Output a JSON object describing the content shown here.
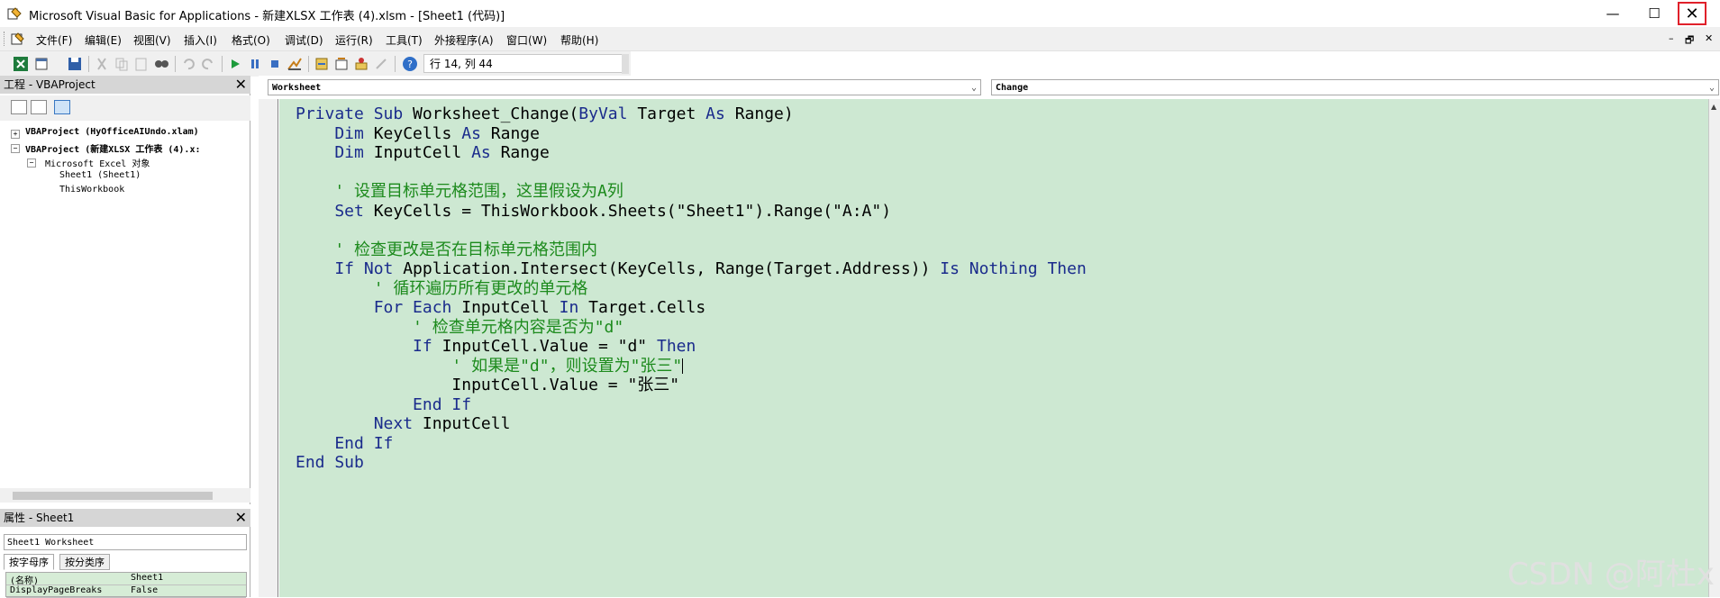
{
  "window": {
    "title": "Microsoft Visual Basic for Applications - 新建XLSX 工作表 (4).xlsm - [Sheet1 (代码)]",
    "minimize": "—",
    "maximize": "☐",
    "close": "✕"
  },
  "menu": {
    "items": [
      "文件(F)",
      "编辑(E)",
      "视图(V)",
      "插入(I)",
      "格式(O)",
      "调试(D)",
      "运行(R)",
      "工具(T)",
      "外接程序(A)",
      "窗口(W)",
      "帮助(H)"
    ],
    "mdi_controls": [
      "–",
      "🗗",
      "✕"
    ]
  },
  "toolbar": {
    "position": "行 14, 列 44"
  },
  "project": {
    "title": "工程 - VBAProject",
    "close": "✕",
    "tree": [
      {
        "label": "VBAProject (HyOfficeAIUndo.xlam)",
        "bold": true
      },
      {
        "label": "VBAProject (新建XLSX 工作表 (4).x:",
        "bold": true
      },
      {
        "label": "Microsoft Excel 对象",
        "bold": false
      },
      {
        "label": "Sheet1 (Sheet1)",
        "bold": false
      },
      {
        "label": "ThisWorkbook",
        "bold": false
      }
    ]
  },
  "properties": {
    "title": "属性 - Sheet1",
    "close": "✕",
    "object": "Sheet1 Worksheet",
    "tabs": [
      "按字母序",
      "按分类序"
    ],
    "rows": [
      {
        "name": "(名称)",
        "value": "Sheet1"
      },
      {
        "name": "DisplayPageBreaks",
        "value": "False"
      }
    ]
  },
  "code_window": {
    "object_dropdown": "Worksheet",
    "procedure_dropdown": "Change",
    "lines": [
      [
        {
          "t": "Private Sub ",
          "c": "kw"
        },
        {
          "t": "Worksheet_Change(",
          "c": ""
        },
        {
          "t": "ByVal ",
          "c": "kw"
        },
        {
          "t": "Target ",
          "c": ""
        },
        {
          "t": "As ",
          "c": "kw"
        },
        {
          "t": "Range)",
          "c": ""
        }
      ],
      [
        {
          "t": "    Dim ",
          "c": "kw"
        },
        {
          "t": "KeyCells ",
          "c": ""
        },
        {
          "t": "As ",
          "c": "kw"
        },
        {
          "t": "Range",
          "c": ""
        }
      ],
      [
        {
          "t": "    Dim ",
          "c": "kw"
        },
        {
          "t": "InputCell ",
          "c": ""
        },
        {
          "t": "As ",
          "c": "kw"
        },
        {
          "t": "Range",
          "c": ""
        }
      ],
      [],
      [
        {
          "t": "    ' 设置目标单元格范围，这里假设为A列",
          "c": "cm"
        }
      ],
      [
        {
          "t": "    Set ",
          "c": "kw"
        },
        {
          "t": "KeyCells = ThisWorkbook.Sheets(\"Sheet1\").Range(\"A:A\")",
          "c": ""
        }
      ],
      [],
      [
        {
          "t": "    ' 检查更改是否在目标单元格范围内",
          "c": "cm"
        }
      ],
      [
        {
          "t": "    If Not ",
          "c": "kw"
        },
        {
          "t": "Application.Intersect(KeyCells, Range(Target.Address)) ",
          "c": ""
        },
        {
          "t": "Is Nothing Then",
          "c": "kw"
        }
      ],
      [
        {
          "t": "        ' 循环遍历所有更改的单元格",
          "c": "cm"
        }
      ],
      [
        {
          "t": "        For Each ",
          "c": "kw"
        },
        {
          "t": "InputCell ",
          "c": ""
        },
        {
          "t": "In ",
          "c": "kw"
        },
        {
          "t": "Target.Cells",
          "c": ""
        }
      ],
      [
        {
          "t": "            ' 检查单元格内容是否为\"d\"",
          "c": "cm"
        }
      ],
      [
        {
          "t": "            If ",
          "c": "kw"
        },
        {
          "t": "InputCell.Value = \"d\" ",
          "c": ""
        },
        {
          "t": "Then",
          "c": "kw"
        }
      ],
      [
        {
          "t": "                ' 如果是\"d\"，则设置为\"张三\"",
          "c": "cm"
        },
        {
          "t": "",
          "c": "cursor"
        }
      ],
      [
        {
          "t": "                InputCell.Value = \"张三\"",
          "c": ""
        }
      ],
      [
        {
          "t": "            End If",
          "c": "kw"
        }
      ],
      [
        {
          "t": "        Next ",
          "c": "kw"
        },
        {
          "t": "InputCell",
          "c": ""
        }
      ],
      [
        {
          "t": "    End If",
          "c": "kw"
        }
      ],
      [
        {
          "t": "End Sub",
          "c": "kw"
        }
      ]
    ]
  },
  "watermark": "CSDN @阿杜x",
  "colors": {
    "code_background": "#cde8d2",
    "keyword": "#1a2b8c",
    "comment": "#1c8a1c",
    "close_highlight": "#e0202a"
  }
}
